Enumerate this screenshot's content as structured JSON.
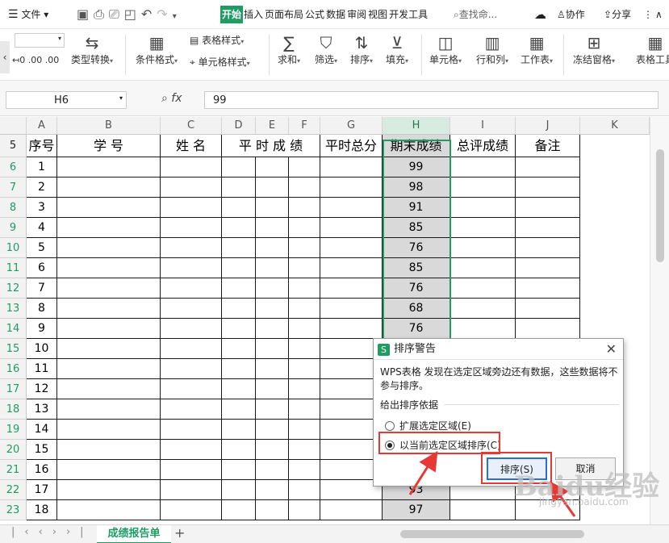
{
  "menubar": {
    "file": "文件",
    "tabs": [
      "开始",
      "插入",
      "页面布局",
      "公式",
      "数据",
      "审阅",
      "视图",
      "开发工具"
    ],
    "active_tab": "开始",
    "search": "查找命...",
    "collab": "协作",
    "share": "分享"
  },
  "ribbon": {
    "type_convert": "类型转换",
    "cond_format": "条件格式",
    "table_style": "表格样式",
    "cell_style": "单元格样式",
    "sum": "求和",
    "filter": "筛选",
    "sort": "排序",
    "fill": "填充",
    "cell": "单元格",
    "rowcol": "行和列",
    "sheet": "工作表",
    "freeze": "冻结窗格",
    "table_tool": "表格工具"
  },
  "formula_bar": {
    "name_box": "H6",
    "fx": "fx",
    "value": "99"
  },
  "grid": {
    "columns": [
      "A",
      "B",
      "C",
      "D",
      "E",
      "F",
      "G",
      "H",
      "I",
      "J",
      "K"
    ],
    "header_row_num": "5",
    "headers": {
      "a": "序号",
      "b": "学    号",
      "c": "姓 名",
      "def": "平 时 成 绩",
      "g": "平时总分",
      "h": "期末成绩",
      "i": "总评成绩",
      "j": "备注"
    },
    "rows": [
      {
        "r": "6",
        "a": "1",
        "h": "99"
      },
      {
        "r": "7",
        "a": "2",
        "h": "98"
      },
      {
        "r": "8",
        "a": "3",
        "h": "91"
      },
      {
        "r": "9",
        "a": "4",
        "h": "85"
      },
      {
        "r": "10",
        "a": "5",
        "h": "76"
      },
      {
        "r": "11",
        "a": "6",
        "h": "85"
      },
      {
        "r": "12",
        "a": "7",
        "h": "76"
      },
      {
        "r": "13",
        "a": "8",
        "h": "68"
      },
      {
        "r": "14",
        "a": "9",
        "h": "76"
      },
      {
        "r": "15",
        "a": "10",
        "h": ""
      },
      {
        "r": "16",
        "a": "11",
        "h": ""
      },
      {
        "r": "17",
        "a": "12",
        "h": ""
      },
      {
        "r": "18",
        "a": "13",
        "h": ""
      },
      {
        "r": "19",
        "a": "14",
        "h": ""
      },
      {
        "r": "20",
        "a": "15",
        "h": ""
      },
      {
        "r": "21",
        "a": "16",
        "h": ""
      },
      {
        "r": "22",
        "a": "17",
        "h": "93"
      },
      {
        "r": "23",
        "a": "18",
        "h": "97"
      }
    ]
  },
  "sheet_tab": "成绩报告单",
  "dialog": {
    "title": "排序警告",
    "message": "WPS表格 发现在选定区域旁边还有数据，这些数据将不参与排序。",
    "group_label": "给出排序依据",
    "option_expand": "扩展选定区域(E)",
    "option_current": "以当前选定区域排序(C)",
    "sort_button": "排序(S)",
    "cancel_button": "取消"
  },
  "watermark": {
    "text": "Baidu经验",
    "sub": "jingyan.baidu.com"
  },
  "colors": {
    "accent": "#1e9c64",
    "highlight": "#e53935"
  }
}
